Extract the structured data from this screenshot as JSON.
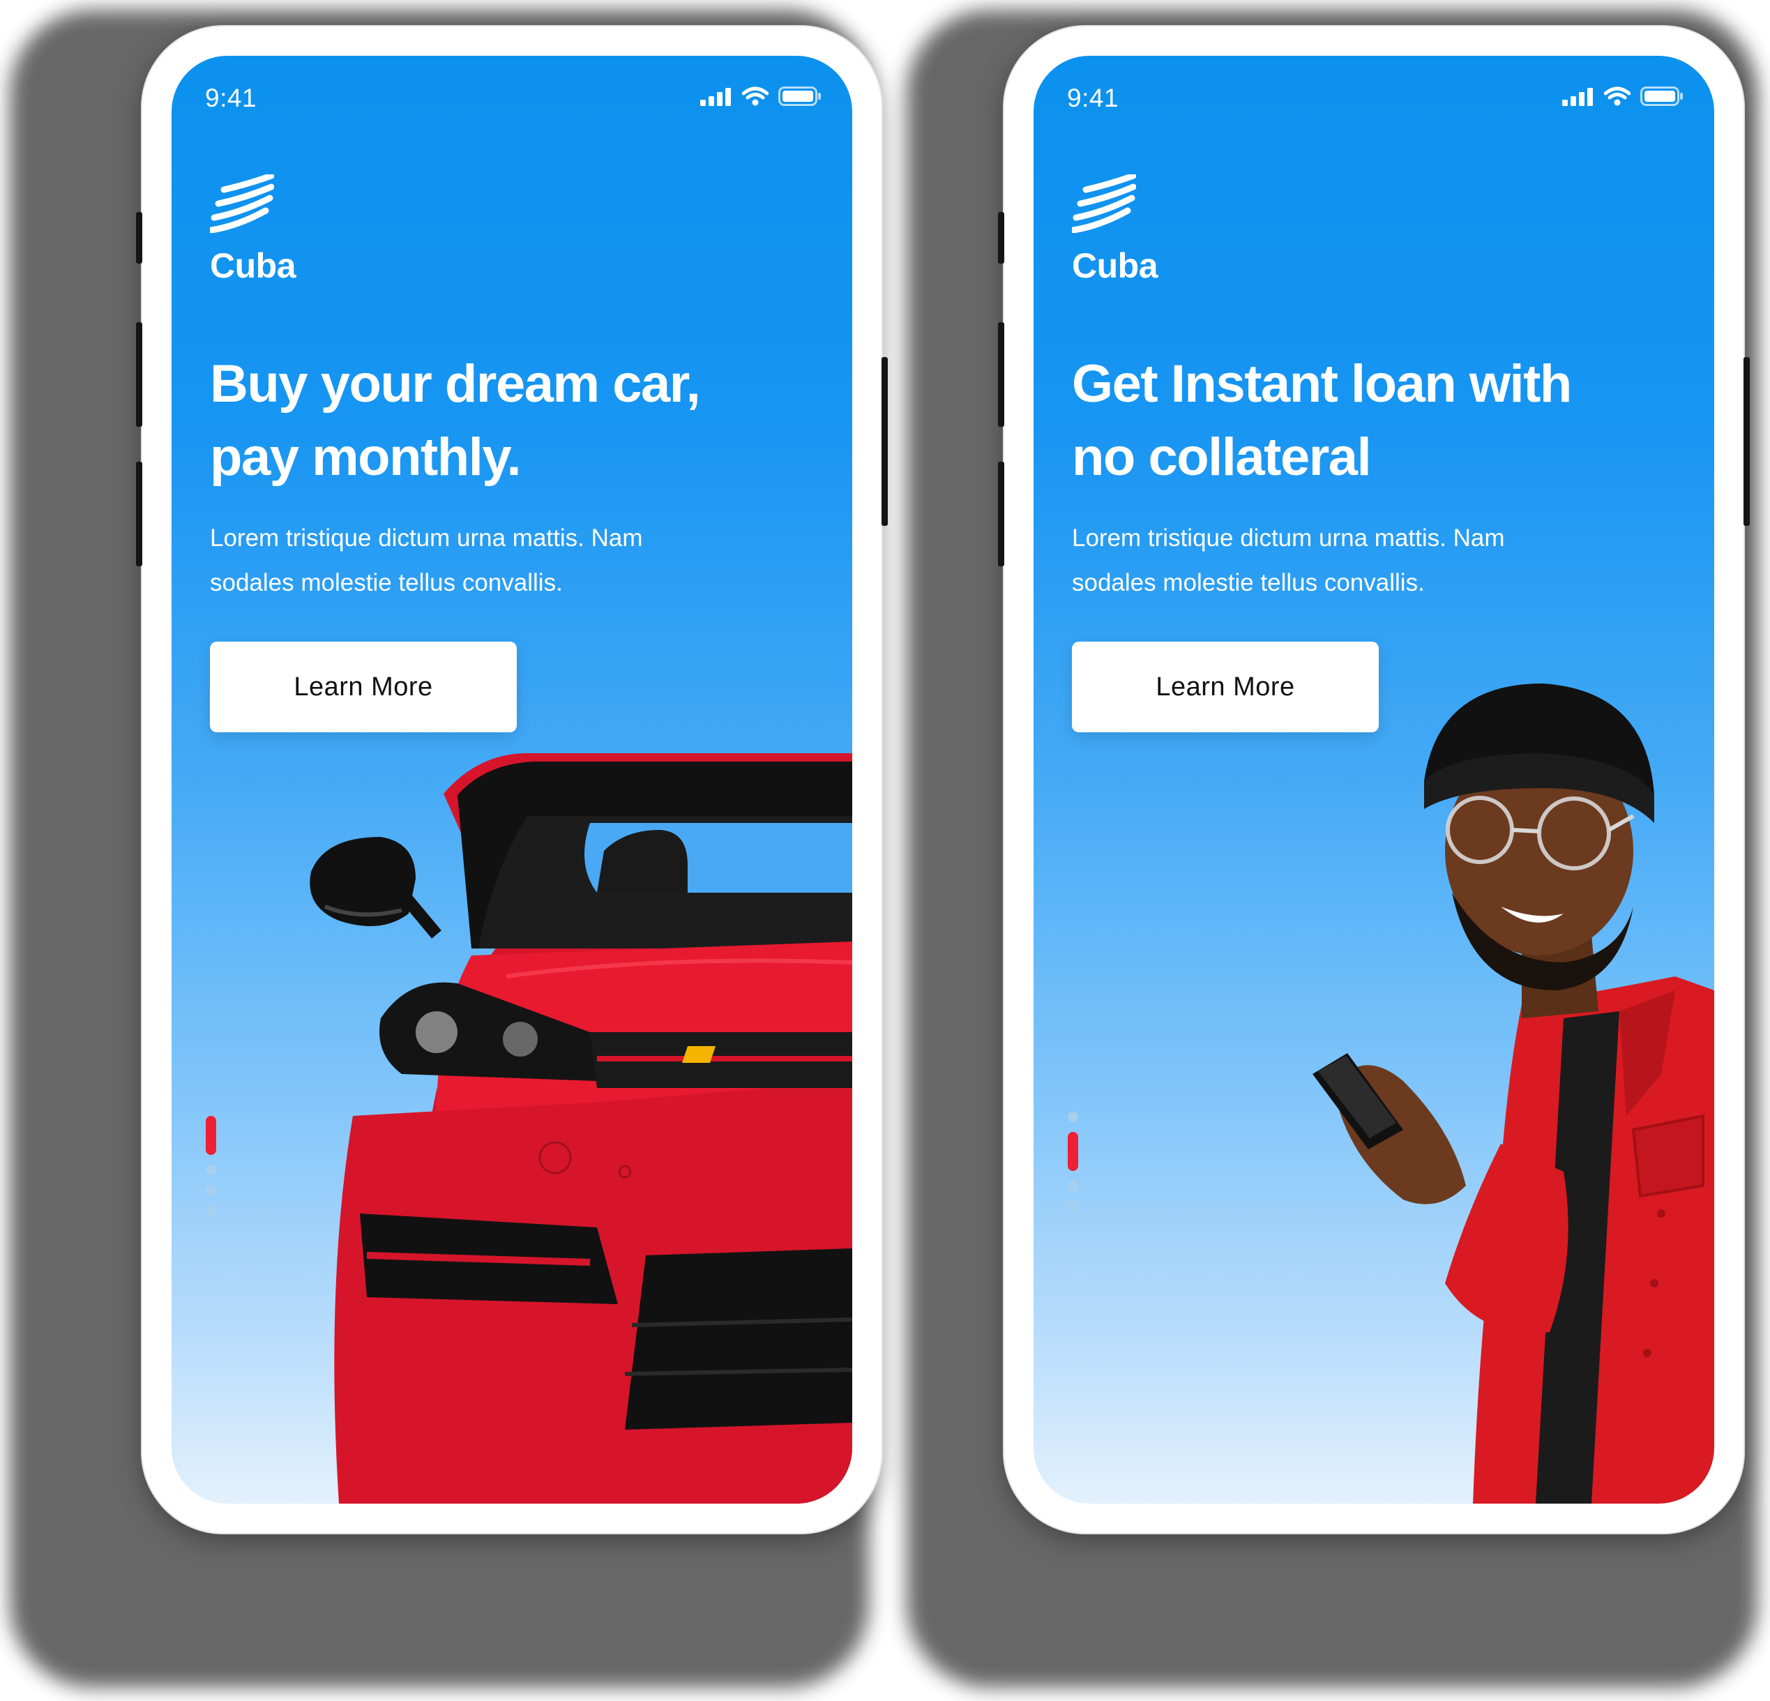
{
  "colors": {
    "brand_blue": "#0b91ee",
    "accent_red": "#ef1f34",
    "button_bg": "#ffffff",
    "text_light": "#ffffff"
  },
  "screens": [
    {
      "status_bar": {
        "time": "9:41",
        "icons": [
          "signal-icon",
          "wifi-icon",
          "battery-icon"
        ]
      },
      "brand": {
        "logo_icon": "stripes-logo-icon",
        "name": "Cuba"
      },
      "headline_line1": "Buy your dream car,",
      "headline_line2": "pay monthly.",
      "body_line1": "Lorem tristique dictum urna mattis. Nam",
      "body_line2": "sodales molestie tellus convallis.",
      "cta_label": "Learn More",
      "hero_image": "red-car-illustration",
      "pagination": {
        "total": 4,
        "active_index": 0
      }
    },
    {
      "status_bar": {
        "time": "9:41",
        "icons": [
          "signal-icon",
          "wifi-icon",
          "battery-icon"
        ]
      },
      "brand": {
        "logo_icon": "stripes-logo-icon",
        "name": "Cuba"
      },
      "headline_line1": "Get Instant loan with",
      "headline_line2": "no collateral",
      "body_line1": "Lorem tristique dictum urna mattis. Nam",
      "body_line2": "sodales molestie tellus convallis.",
      "cta_label": "Learn More",
      "hero_image": "man-with-phone-illustration",
      "pagination": {
        "total": 4,
        "active_index": 1
      }
    }
  ]
}
